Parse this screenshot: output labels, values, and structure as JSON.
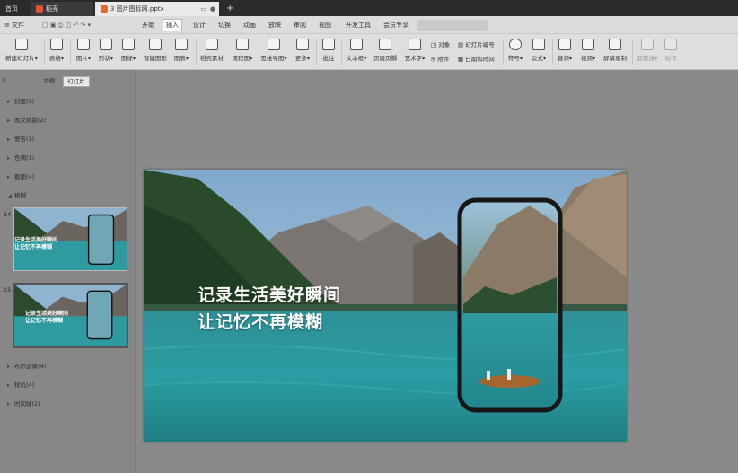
{
  "tabs": [
    {
      "label": "首页"
    },
    {
      "label": "稻壳"
    },
    {
      "label": "3 图片图标网.pptx"
    }
  ],
  "new_tab_symbol": "+",
  "file_menu": "文件",
  "menus": [
    "开始",
    "插入",
    "设计",
    "切换",
    "动画",
    "放映",
    "审阅",
    "视图",
    "开发工具",
    "会员专享"
  ],
  "active_menu": "插入",
  "ribbon": {
    "new_slide": "新建幻灯片",
    "table": "表格",
    "picture": "图片",
    "shape": "形状",
    "icon": "图标",
    "smart_graphic": "智能图形",
    "chart": "图表",
    "docer_material": "稻壳素材",
    "flowchart": "流程图",
    "mindmap": "思维导图",
    "more": "更多",
    "comment": "批注",
    "textbox": "文本框",
    "header_footer": "页眉页脚",
    "wordart": "艺术字",
    "object": "对象",
    "slide_number": "幻灯片编号",
    "attachment": "附件",
    "datetime": "日期和时间",
    "symbol": "符号",
    "formula": "公式",
    "audio": "音频",
    "video": "视频",
    "screen_record": "屏幕录制",
    "hyperlink": "超链接",
    "action": "动作"
  },
  "panel": {
    "tab_outline": "大纲",
    "tab_slides": "幻灯片",
    "sections_top": [
      "封面(1)",
      "图文排版(2)",
      "警告(1)",
      "色调(1)",
      "截图(4)"
    ],
    "section_expanded": "模糊",
    "sections_bottom": [
      "布尔运算(4)",
      "样机(4)",
      "时间轴(2)"
    ],
    "slides": [
      {
        "number": "14",
        "line1": "记录生活美好瞬间",
        "line2": "让记忆不再模糊"
      },
      {
        "number": "15",
        "line1": "记录生活美好瞬间",
        "line2": "让记忆不再模糊"
      }
    ]
  },
  "slide": {
    "line1": "记录生活美好瞬间",
    "line2": "让记忆不再模糊"
  },
  "colors": {
    "tabbar": "#2b2b2b",
    "ribbon": "#dedede",
    "panel": "#878787",
    "workspace": "#8a8a8a",
    "lake": "#2f9aa0"
  }
}
